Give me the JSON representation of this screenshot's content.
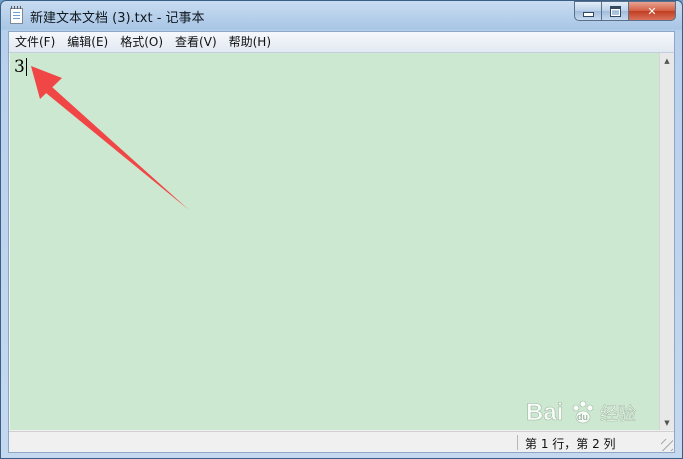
{
  "window": {
    "title": "新建文本文档 (3).txt - 记事本"
  },
  "title_controls": {
    "minimize_icon": "minimize-icon",
    "maximize_icon": "maximize-icon",
    "close_glyph": "✕"
  },
  "menu": {
    "items": [
      {
        "label": "文件(F)"
      },
      {
        "label": "编辑(E)"
      },
      {
        "label": "格式(O)"
      },
      {
        "label": "查看(V)"
      },
      {
        "label": "帮助(H)"
      }
    ]
  },
  "editor": {
    "content": "3",
    "background": "#cde8d0"
  },
  "scrollbar": {
    "up_glyph": "▲",
    "down_glyph": "▼"
  },
  "statusbar": {
    "position": "第 1 行，第 2 列"
  },
  "annotation": {
    "arrow_color": "#f04646"
  },
  "watermark": {
    "brand": "Bai",
    "brand_suffix": "du",
    "text": "经验"
  }
}
